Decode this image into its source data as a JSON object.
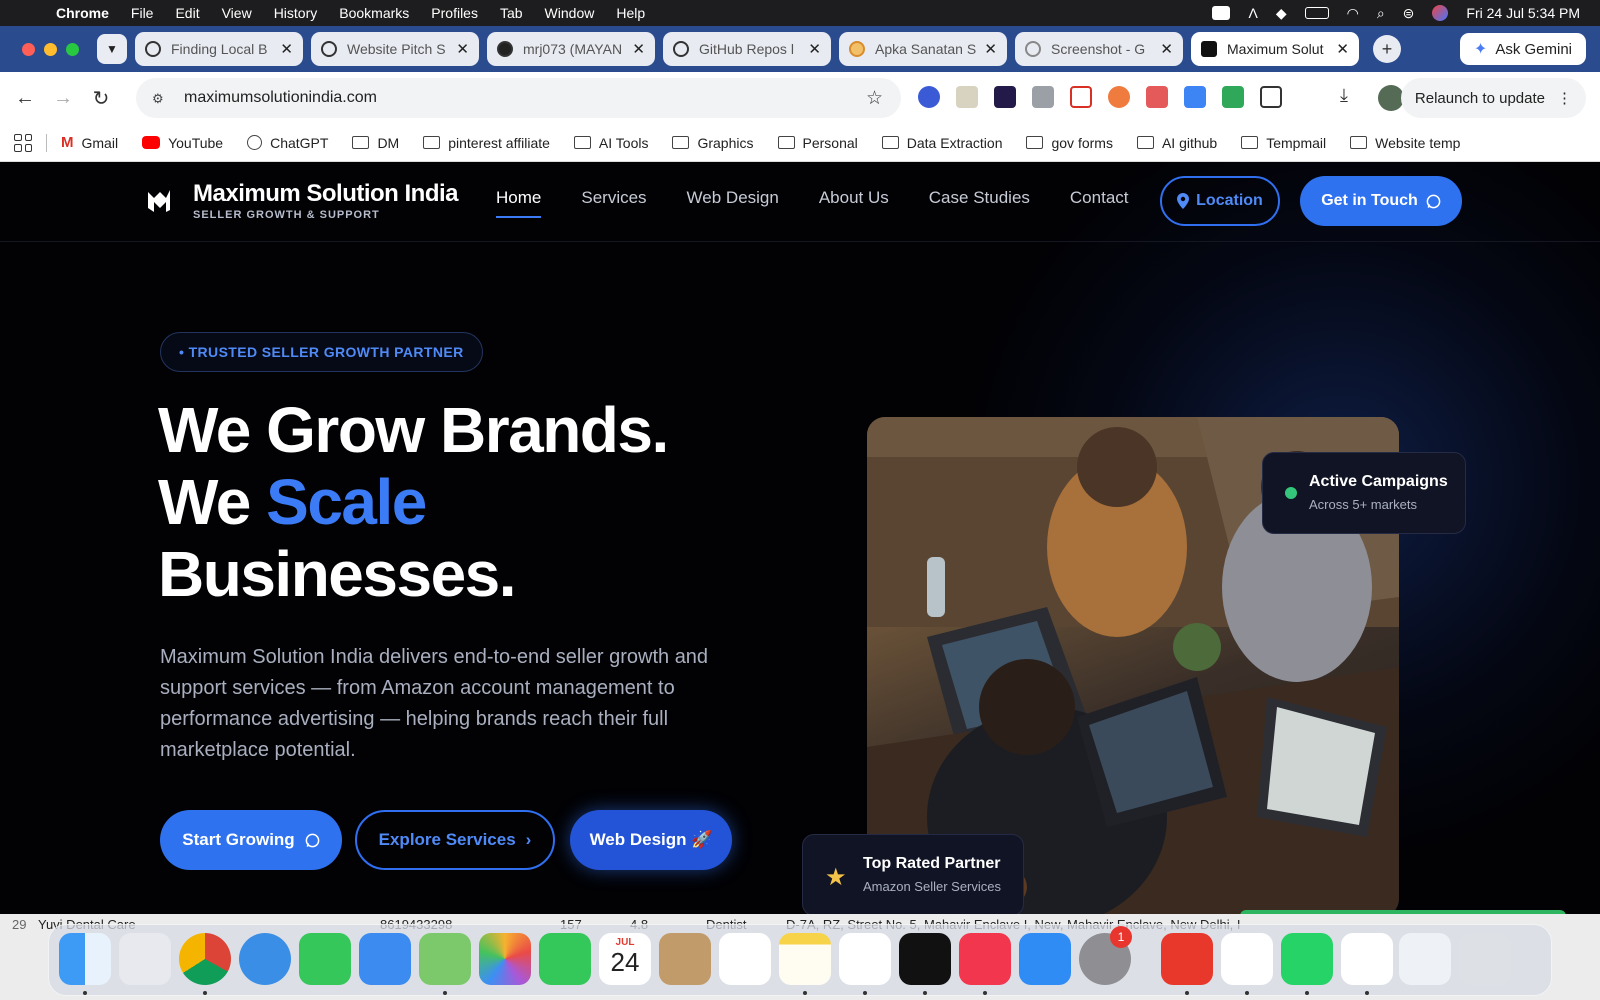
{
  "menubar": {
    "app": "Chrome",
    "items": [
      "File",
      "Edit",
      "View",
      "History",
      "Bookmarks",
      "Profiles",
      "Tab",
      "Window",
      "Help"
    ],
    "datetime": "Fri 24 Jul  5:34 PM"
  },
  "tabs": [
    {
      "label": "Finding Local B",
      "active": false
    },
    {
      "label": "Website Pitch S",
      "active": false
    },
    {
      "label": "mrj073 (MAYAN",
      "active": false
    },
    {
      "label": "GitHub Repos l",
      "active": false
    },
    {
      "label": "Apka Sanatan S",
      "active": false
    },
    {
      "label": "Screenshot - G",
      "active": false
    },
    {
      "label": "Maximum Solut",
      "active": true
    }
  ],
  "gemini": {
    "label": "Ask Gemini"
  },
  "omnibox": {
    "url": "maximumsolutionindia.com"
  },
  "relaunch": {
    "label": "Relaunch to update"
  },
  "bookmarks": [
    {
      "label": "Gmail",
      "icon": "gmail-icon"
    },
    {
      "label": "YouTube",
      "icon": "youtube-icon"
    },
    {
      "label": "ChatGPT",
      "icon": "chatgpt-icon"
    },
    {
      "label": "DM",
      "icon": "folder-icon"
    },
    {
      "label": "pinterest affiliate",
      "icon": "folder-icon"
    },
    {
      "label": "AI Tools",
      "icon": "folder-icon"
    },
    {
      "label": "Graphics",
      "icon": "folder-icon"
    },
    {
      "label": "Personal",
      "icon": "folder-icon"
    },
    {
      "label": "Data Extraction",
      "icon": "folder-icon"
    },
    {
      "label": "gov forms",
      "icon": "folder-icon"
    },
    {
      "label": "AI github",
      "icon": "folder-icon"
    },
    {
      "label": "Tempmail",
      "icon": "folder-icon"
    },
    {
      "label": "Website temp",
      "icon": "folder-icon"
    }
  ],
  "site": {
    "logo_title": "Maximum Solution India",
    "logo_sub": "SELLER GROWTH & SUPPORT",
    "nav": [
      {
        "label": "Home",
        "active": true
      },
      {
        "label": "Services",
        "active": false
      },
      {
        "label": "Web Design",
        "active": false
      },
      {
        "label": "About Us",
        "active": false
      },
      {
        "label": "Case Studies",
        "active": false
      },
      {
        "label": "Contact",
        "active": false
      }
    ],
    "location_btn": "Location",
    "touch_btn": "Get in Touch",
    "badge": "• TRUSTED SELLER GROWTH PARTNER",
    "hero_line1": "We Grow Brands.",
    "hero_line2_a": "We ",
    "hero_line2_b": "Scale",
    "hero_line3": "Businesses.",
    "hero_desc": "Maximum Solution India delivers end-to-end seller growth and support services — from Amazon account management to performance advertising — helping brands reach their full marketplace potential.",
    "cta_start": "Start Growing",
    "cta_explore": "Explore Services",
    "cta_web": "Web Design 🚀",
    "card_active_title": "Active Campaigns",
    "card_active_sub": "Across 5+ markets",
    "card_top_title": "Top Rated Partner",
    "card_top_sub": "Amazon Seller Services"
  },
  "sheet_peek": {
    "row_num": "29",
    "name": "Yuvi Dental Care",
    "phone": "8619433298",
    "reviews": "157",
    "rating": "4.8",
    "category": "Dentist",
    "address": "D-7A, RZ, Street No. 5, Mahavir Enclave I, New, Mahavir Enclave, New Delhi, I"
  },
  "dock": {
    "calendar_month": "JUL",
    "calendar_day": "24",
    "settings_badge": "1"
  },
  "colors": {
    "accent_blue": "#2f72f0",
    "site_bg": "#020205",
    "tabstrip": "#2b4b8f"
  }
}
